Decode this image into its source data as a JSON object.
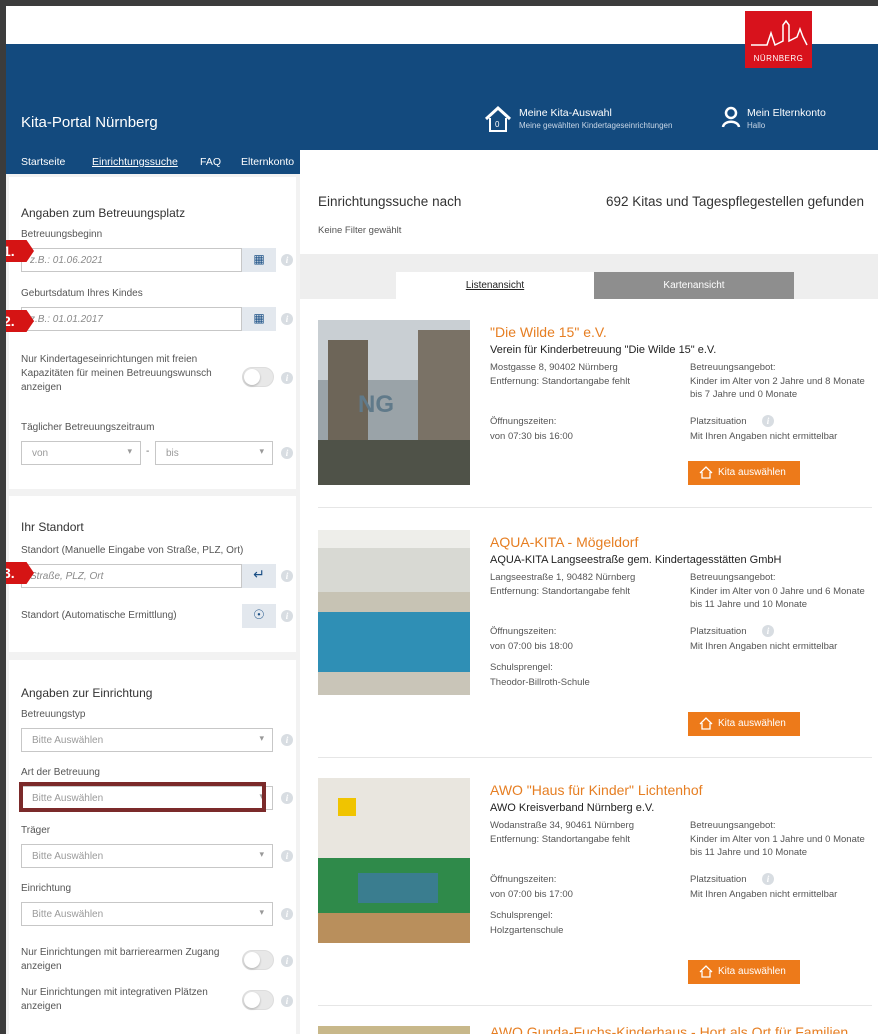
{
  "header": {
    "logo_text": "NÜRNBERG",
    "portal_title": "Kita-Portal Nürnberg",
    "kita_selection": {
      "title": "Meine Kita-Auswahl",
      "subtitle": "Meine gewählten Kindertageseinrichtungen",
      "count": "0"
    },
    "account": {
      "title": "Mein Elternkonto",
      "subtitle": "Hallo"
    }
  },
  "nav": {
    "items": [
      "Startseite",
      "Einrichtungssuche",
      "FAQ",
      "Elternkonto"
    ]
  },
  "sidebar": {
    "care": {
      "title": "Angaben zum Betreuungsplatz",
      "start_label": "Betreuungsbeginn",
      "start_placeholder": "z.B.: 01.06.2021",
      "birth_label": "Geburtsdatum Ihres Kindes",
      "birth_placeholder": "z.B.: 01.01.2017",
      "free_capacity_label": "Nur Kindertageseinrichtungen mit freien Kapazitäten für meinen Betreuungswunsch anzeigen",
      "daily_label": "Täglicher Betreuungszeitraum",
      "from": "von",
      "dash": "-",
      "to": "bis"
    },
    "location": {
      "title": "Ihr Standort",
      "manual_label": "Standort (Manuelle Eingabe von Straße, PLZ, Ort)",
      "manual_placeholder": "Straße, PLZ, Ort",
      "auto_label": "Standort (Automatische Ermittlung)"
    },
    "facility": {
      "title": "Angaben zur Einrichtung",
      "type_label": "Betreuungstyp",
      "kind_label": "Art der Betreuung",
      "provider_label": "Träger",
      "facility_label": "Einrichtung",
      "placeholder": "Bitte Auswählen",
      "barrier_label": "Nur Einrichtungen mit barrierearmen Zugang anzeigen",
      "integrative_label": "Nur Einrichtungen mit integrativen Plätzen anzeigen"
    },
    "markers": [
      "1.",
      "2.",
      "3."
    ]
  },
  "main": {
    "search_title": "Einrichtungssuche nach",
    "result_count": "692 Kitas und Tagespflegestellen gefunden",
    "no_filter": "Keine Filter gewählt",
    "tab_list": "Listenansicht",
    "tab_map": "Kartenansicht",
    "care_offer_label": "Betreuungsangebot:",
    "opening_label": "Öffnungszeiten:",
    "place_label": "Platzsituation",
    "school_label": "Schulsprengel:",
    "select_label": "Kita auswählen",
    "cards": [
      {
        "name": "\"Die Wilde 15\" e.V.",
        "org": "Verein für Kinderbetreuung \"Die Wilde 15\" e.V.",
        "address": "Mostgasse 8, 90402 Nürnberg",
        "distance": "Entfernung: Standortangabe fehlt",
        "care_offer": "Kinder im Alter von 2 Jahre und 8 Monate bis 7 Jahre und 0 Monate",
        "hours": "von 07:30 bis 16:00",
        "place_status": "Mit Ihren Angaben nicht ermittelbar",
        "school": ""
      },
      {
        "name": "AQUA-KITA - Mögeldorf",
        "org": "AQUA-KITA Langseestraße gem. Kindertagesstätten GmbH",
        "address": "Langseestraße 1, 90482 Nürnberg",
        "distance": "Entfernung: Standortangabe fehlt",
        "care_offer": "Kinder im Alter von 0 Jahre und 6 Monate bis 11 Jahre und 10 Monate",
        "hours": "von 07:00 bis 18:00",
        "place_status": "Mit Ihren Angaben nicht ermittelbar",
        "school": "Theodor-Billroth-Schule"
      },
      {
        "name": "AWO \"Haus für Kinder\" Lichtenhof",
        "org": "AWO Kreisverband Nürnberg e.V.",
        "address": "Wodanstraße 34, 90461 Nürnberg",
        "distance": "Entfernung: Standortangabe fehlt",
        "care_offer": "Kinder im Alter von 1 Jahre und 0 Monate bis 11 Jahre und 10 Monate",
        "hours": "von 07:00 bis 17:00",
        "place_status": "Mit Ihren Angaben nicht ermittelbar",
        "school": "Holzgartenschule"
      },
      {
        "name": "AWO Gunda-Fuchs-Kinderhaus - Hort als Ort für Familien"
      }
    ]
  },
  "colors": {
    "brand": "#134a7e",
    "accent": "#ed7a1a",
    "logo": "#d8121c",
    "marker": "#d51414"
  }
}
